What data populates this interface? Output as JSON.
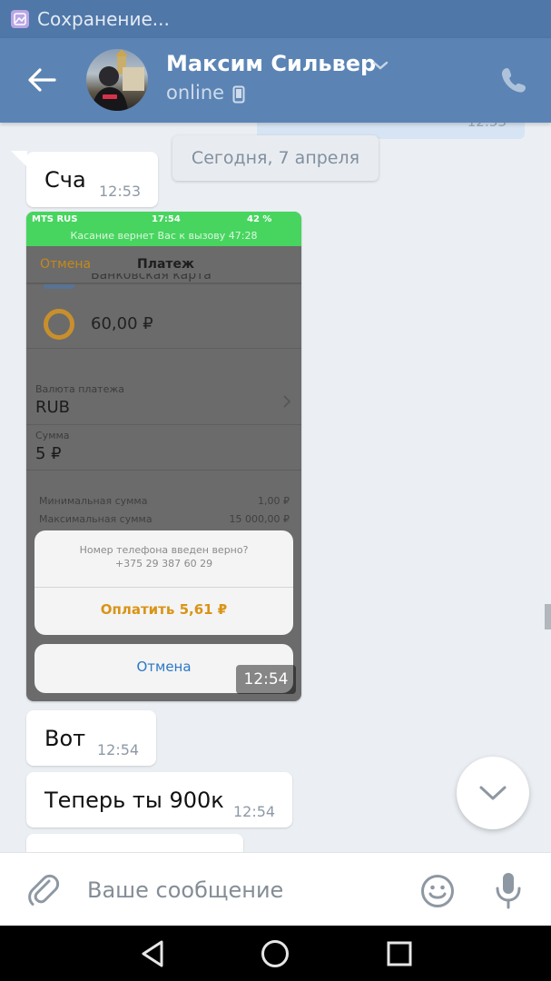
{
  "status_bar": {
    "notification_text": "Сохранение..."
  },
  "header": {
    "contact_name": "Максим Сильвер",
    "status": "online"
  },
  "chat": {
    "outgoing_partial_time": "12:53",
    "date_separator": "Сегодня, 7 апреля",
    "messages": [
      {
        "text": "Сча",
        "time": "12:53"
      },
      {
        "text": "Вот",
        "time": "12:54"
      },
      {
        "text": "Теперь ты 900к",
        "time": "12:54"
      }
    ],
    "image_message": {
      "time": "12:54",
      "ios_status": {
        "carrier": "MTS RUS",
        "clock": "17:54",
        "battery": "42 %"
      },
      "call_banner": "Касание вернет Вас к вызову 47:28",
      "nav": {
        "cancel": "Отмена",
        "title": "Платеж"
      },
      "card_partial": "Банковская карта",
      "amount": "60,00 ₽",
      "currency_label": "Валюта платежа",
      "currency_value": "RUB",
      "sum_label": "Сумма",
      "sum_value": "5 ₽",
      "min_label": "Минимальная сумма",
      "min_value": "1,00 ₽",
      "max_label": "Максимальная сумма",
      "max_value": "15 000,00 ₽",
      "sheet_question": "Номер телефона введен верно?",
      "sheet_phone": "+375 29 387 60 29",
      "sheet_pay": "Оплатить 5,61 ₽",
      "sheet_cancel": "Отмена"
    }
  },
  "composer": {
    "placeholder": "Ваше сообщение"
  },
  "colors": {
    "header": "#5b84b5",
    "status_bar": "#4f77a8",
    "chat_bg": "#ebeff3",
    "icon_gray": "#8e98a3"
  },
  "icons": [
    "gallery-icon",
    "back-arrow-icon",
    "chevron-down-icon",
    "mobile-device-icon",
    "phone-icon",
    "attach-icon",
    "emoji-icon",
    "mic-icon",
    "nav-back-icon",
    "nav-home-icon",
    "nav-recents-icon"
  ]
}
